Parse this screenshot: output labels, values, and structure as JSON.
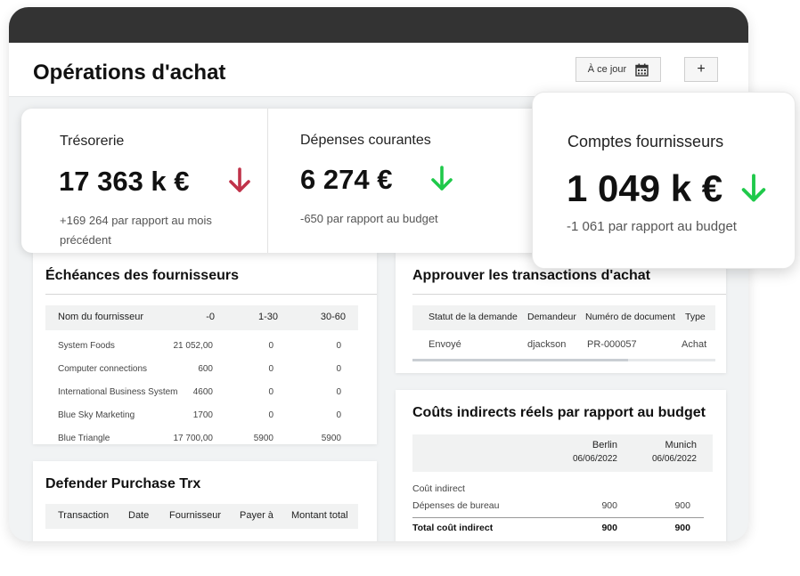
{
  "header": {
    "title": "Opérations d'achat",
    "date_filter_label": "À ce jour",
    "add_label": "+"
  },
  "kpis": [
    {
      "label": "Trésorerie",
      "value": "17 363 k €",
      "sub_line1": "+169 264 par rapport au mois",
      "sub_line2": "précédent",
      "trend": "down",
      "trend_color": "#c0334a"
    },
    {
      "label": "Dépenses courantes",
      "value": "6 274 €",
      "sub_line1": "-650 par rapport au budget",
      "trend": "down",
      "trend_color": "#1fc94a"
    },
    {
      "label": "Comptes fournisseurs",
      "value": "1 049 k €",
      "sub_line1": "-1 061 par rapport au budget",
      "trend": "down",
      "trend_color": "#1fc94a"
    }
  ],
  "supplier_due": {
    "title": "Échéances des fournisseurs",
    "columns": [
      "Nom du fournisseur",
      "-0",
      "1-30",
      "30-60"
    ],
    "rows": [
      [
        "System Foods",
        "21 052,00",
        "0",
        "0"
      ],
      [
        "Computer connections",
        "600",
        "0",
        "0"
      ],
      [
        "International Business System",
        "4600",
        "0",
        "0"
      ],
      [
        "Blue Sky Marketing",
        "1700",
        "0",
        "0"
      ],
      [
        "Blue Triangle",
        "17 700,00",
        "5900",
        "5900"
      ]
    ]
  },
  "approve": {
    "title": "Approuver les transactions d'achat",
    "columns": [
      "Statut de la demande",
      "Demandeur",
      "Numéro de document",
      "Type"
    ],
    "rows": [
      [
        "Envoyé",
        "djackson",
        "PR-000057",
        "Achat"
      ]
    ]
  },
  "defender": {
    "title": "Defender Purchase Trx",
    "columns": [
      "Transaction",
      "Date",
      "Fournisseur",
      "Payer à",
      "Montant total"
    ]
  },
  "indirect": {
    "title": "Coûts indirects réels par rapport au budget",
    "col1_name": "Berlin",
    "col1_date": "06/06/2022",
    "col2_name": "Munich",
    "col2_date": "06/06/2022",
    "group_label": "Coût indirect",
    "rows": [
      [
        "Dépenses de bureau",
        "900",
        "900"
      ]
    ],
    "total": [
      "Total coût indirect",
      "900",
      "900"
    ]
  },
  "colors": {
    "topbar": "#333333",
    "down_red": "#c0334a",
    "down_green": "#1fc94a"
  }
}
